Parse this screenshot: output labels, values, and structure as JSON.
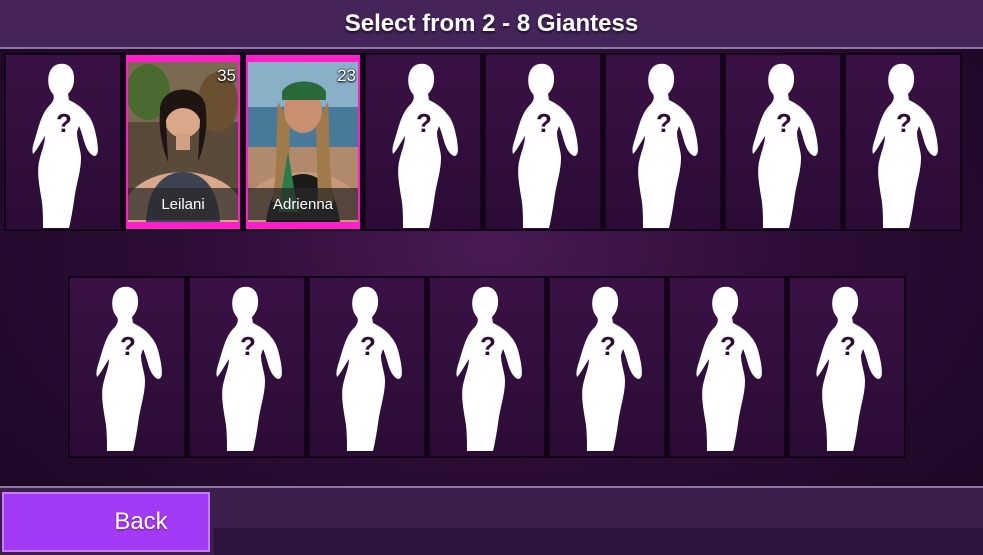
{
  "header": {
    "title": "Select from 2 - 8 Giantess"
  },
  "row1": [
    {
      "type": "empty"
    },
    {
      "type": "selected",
      "name": "Leilani",
      "age": "35",
      "portrait": "dark-haired woman portrait"
    },
    {
      "type": "selected",
      "name": "Adrienna",
      "age": "23",
      "portrait": "woman with green bandana portrait"
    },
    {
      "type": "empty"
    },
    {
      "type": "empty"
    },
    {
      "type": "empty"
    },
    {
      "type": "empty"
    },
    {
      "type": "empty"
    }
  ],
  "row2": [
    {
      "type": "empty"
    },
    {
      "type": "empty"
    },
    {
      "type": "empty"
    },
    {
      "type": "empty"
    },
    {
      "type": "empty"
    },
    {
      "type": "empty"
    },
    {
      "type": "empty"
    }
  ],
  "footer": {
    "back_label": "Back"
  },
  "colors": {
    "selected_border": "#ff1ec8",
    "back_button": "#a33af5",
    "header": "#45245a"
  },
  "icons": {
    "empty_slot": "silhouette-question-icon"
  }
}
